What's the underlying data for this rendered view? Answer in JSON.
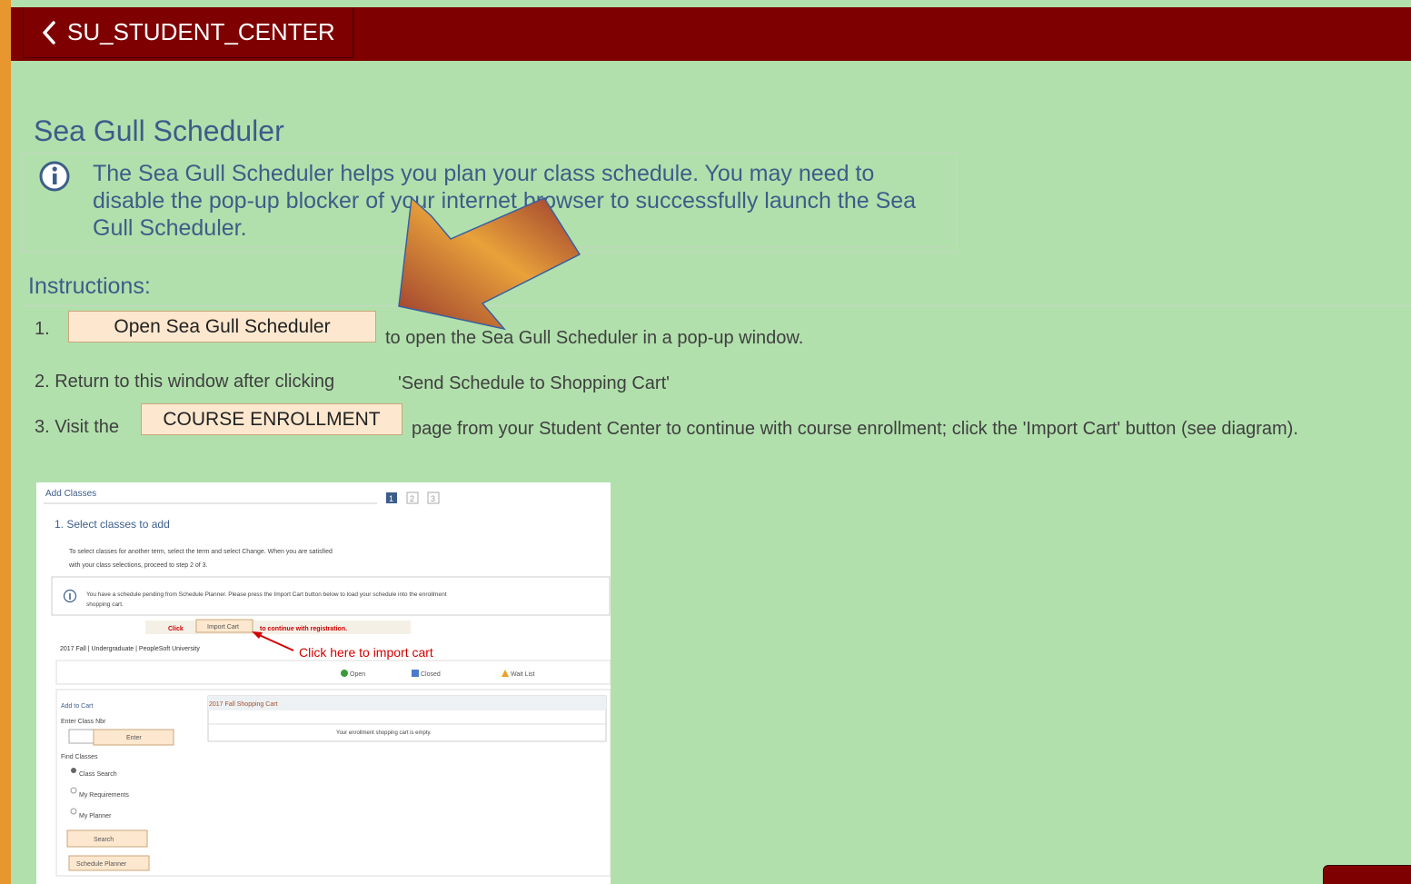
{
  "header": {
    "back_label": "SU_STUDENT_CENTER"
  },
  "page": {
    "title": "Sea Gull Scheduler",
    "info_text": "The Sea Gull Scheduler helps you plan your class schedule.  You may need to disable the pop-up blocker of your internet browser to successfully launch the Sea Gull Scheduler."
  },
  "instructions": {
    "title": "Instructions:",
    "step1_num": "1.",
    "step1_button": "Open Sea Gull Scheduler",
    "step1_text": "to open the Sea Gull Scheduler in a pop-up window.",
    "step2_text": "2. Return to this window after clicking",
    "step2_quote": "'Send Schedule to Shopping Cart'",
    "step3_prefix": "3. Visit the",
    "step3_button": "COURSE ENROLLMENT",
    "step3_text": "page from your Student Center to continue with course enrollment; click the 'Import Cart' button (see diagram)."
  },
  "diagram": {
    "header": "Add Classes",
    "steps": [
      "1",
      "2",
      "3"
    ],
    "step_title": "1.  Select classes to add",
    "desc_line1": "To select classes for another term, select the term and select Change.  When you are satisfied",
    "desc_line2": "with your class selections, proceed to step 2 of 3.",
    "notice_line1": "You have a schedule pending from Schedule Planner. Please press the Import Cart button below to load your schedule into the enrollment",
    "notice_line2": "shopping cart.",
    "click_label": "Click",
    "import_button": "Import Cart",
    "continue_text": "to continue with registration.",
    "callout": "Click here to import cart",
    "term": "2017 Fall | Undergraduate | PeopleSoft University",
    "legend": [
      "Open",
      "Closed",
      "Wait List"
    ],
    "add_to_cart": "Add to Cart",
    "enter_class_nbr": "Enter Class Nbr",
    "enter_button": "Enter",
    "find_classes": "Find Classes",
    "options": [
      "Class Search",
      "My Requirements",
      "My Planner"
    ],
    "search_button": "Search",
    "planner_button": "Schedule Planner",
    "cart_title": "2017 Fall Shopping Cart",
    "cart_empty": "Your enrollment shopping cart is empty."
  },
  "colors": {
    "header_bg": "#7e0000",
    "page_bg": "#b1e0ac",
    "border": "#e8962e",
    "title": "#3c5d8a",
    "button_bg": "#fde8cf"
  }
}
